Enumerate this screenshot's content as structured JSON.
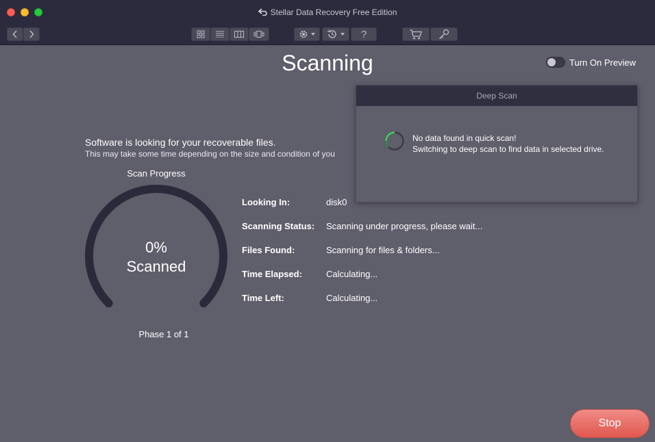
{
  "window": {
    "title": "Stellar Data Recovery Free Edition"
  },
  "toolbar": {
    "buttons": [
      "back",
      "forward",
      "icon-view",
      "list-view",
      "column-view",
      "coverflow-view",
      "settings",
      "history",
      "help",
      "cart",
      "activate"
    ],
    "help_label": "?"
  },
  "main": {
    "heading": "Scanning",
    "preview_toggle_label": "Turn On Preview",
    "preview_enabled": false,
    "status_title": "Software is looking for your recoverable files.",
    "status_subtitle": "This may take some time depending on the size and condition of you",
    "progress_label": "Scan Progress",
    "progress_percent_text": "0%",
    "progress_percent": 0,
    "progress_scanned_text": "Scanned",
    "phase": "Phase 1 of 1",
    "info": [
      {
        "key": "Looking In:",
        "value": "disk0"
      },
      {
        "key": "Scanning Status:",
        "value": "Scanning under progress, please wait..."
      },
      {
        "key": "Files Found:",
        "value": "Scanning for files & folders..."
      },
      {
        "key": "Time Elapsed:",
        "value": "Calculating..."
      },
      {
        "key": "Time Left:",
        "value": "Calculating..."
      }
    ],
    "stop_label": "Stop"
  },
  "popover": {
    "title": "Deep Scan",
    "message_line1": "No data found in quick scan!",
    "message_line2": "Switching to deep scan to find data in selected drive."
  },
  "colors": {
    "accent_green": "#3ecf5a",
    "stop_red": "#e8675f",
    "gauge_track": "#2b2a3a"
  }
}
